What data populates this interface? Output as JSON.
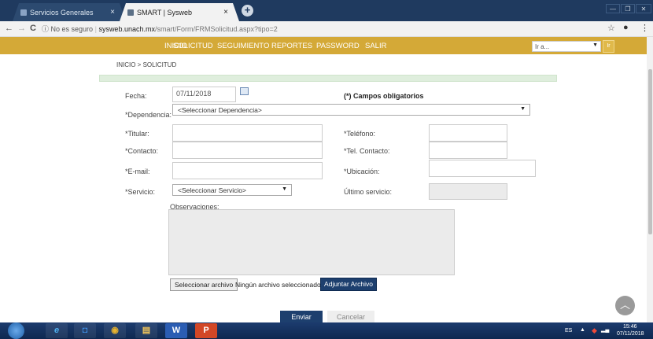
{
  "browser": {
    "tabs": [
      {
        "label": "Servicios Generales",
        "close": "×"
      },
      {
        "label": "SMART | Sysweb",
        "close": "×"
      }
    ],
    "new_tab": "+",
    "window_controls": {
      "minimize": "—",
      "restore": "❐",
      "close": "✕"
    },
    "nav": {
      "back": "←",
      "forward": "→",
      "reload": "C"
    },
    "url": {
      "security": "No es seguro",
      "separator": "|",
      "host": "sysweb.unach.mx",
      "path": "/smart/Form/FRMSolicitud.aspx?tipo=2"
    },
    "icons": {
      "star": "☆",
      "profile": "●",
      "menu": "⋮"
    }
  },
  "site_nav": {
    "items": [
      "INICIO",
      "SOLICITUD",
      "SEGUIMIENTO",
      "REPORTES",
      "PASSWORD",
      "SALIR"
    ],
    "goto_placeholder": "Ir a...",
    "goto_button": "Ir"
  },
  "breadcrumb": "INICIO > SOLICITUD",
  "form": {
    "fecha_label": "Fecha:",
    "fecha_value": "07/11/2018",
    "required_note": "(*) Campos obligatorios",
    "dependencia_label": "*Dependencia:",
    "dependencia_value": "<Seleccionar Dependencia>",
    "titular_label": "*Titular:",
    "telefono_label": "*Teléfono:",
    "contacto_label": "*Contacto:",
    "tel_contacto_label": "*Tel. Contacto:",
    "email_label": "*E-mail:",
    "ubicacion_label": "*Ubicación:",
    "servicio_label": "*Servicio:",
    "servicio_value": "<Seleccionar Servicio>",
    "ultimo_servicio_label": "Último servicio:",
    "observaciones_label": "Observaciones:",
    "file_button": "Seleccionar archivo",
    "file_status": "Ningún archivo seleccionado",
    "attach_button": "Adjuntar Archivo",
    "send_button": "Enviar",
    "cancel_button": "Cancelar"
  },
  "taskbar": {
    "lang": "ES",
    "time": "15:46",
    "date": "07/11/2018",
    "apps": [
      "e",
      "◘",
      "◉",
      "▤",
      "W",
      "P"
    ]
  },
  "colors": {
    "nav_bg": "#d4a937",
    "primary_btn": "#1d3f6e",
    "tabstrip": "#1f3a5f"
  }
}
